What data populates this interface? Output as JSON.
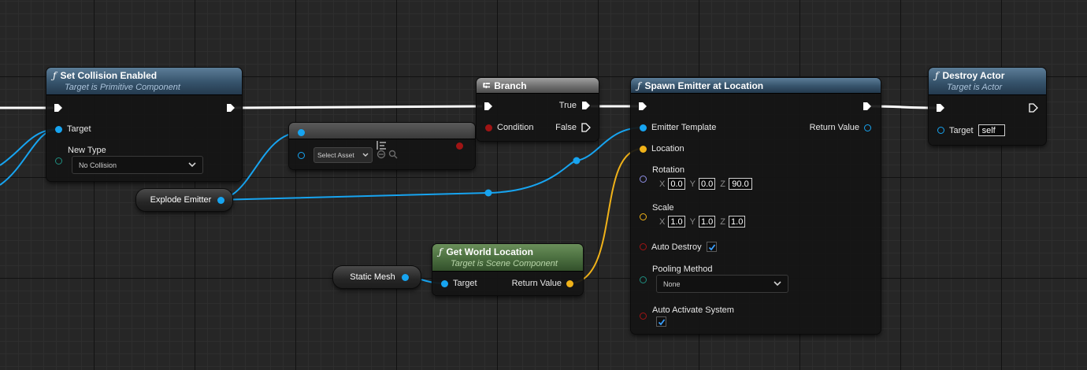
{
  "nodes": {
    "set_collision": {
      "title": "Set Collision Enabled",
      "subtitle": "Target is Primitive Component",
      "target_label": "Target",
      "new_type_label": "New Type",
      "new_type_value": "No Collision"
    },
    "select_asset": {
      "value": "Select Asset"
    },
    "branch": {
      "title": "Branch",
      "true_label": "True",
      "condition_label": "Condition",
      "false_label": "False"
    },
    "spawn_emitter": {
      "title": "Spawn Emitter at Location",
      "emitter_template_label": "Emitter Template",
      "return_value_label": "Return Value",
      "location_label": "Location",
      "rotation_label": "Rotation",
      "rotation": {
        "x": "0.0",
        "y": "0.0",
        "z": "90.0"
      },
      "scale_label": "Scale",
      "scale": {
        "x": "1.0",
        "y": "1.0",
        "z": "1.0"
      },
      "axis_x": "X",
      "axis_y": "Y",
      "axis_z": "Z",
      "auto_destroy_label": "Auto Destroy",
      "pooling_method_label": "Pooling Method",
      "pooling_method_value": "None",
      "auto_activate_label": "Auto Activate System"
    },
    "destroy_actor": {
      "title": "Destroy Actor",
      "subtitle": "Target is Actor",
      "target_label": "Target",
      "target_value": "self"
    },
    "get_world_location": {
      "title": "Get World Location",
      "subtitle": "Target is Scene Component",
      "target_label": "Target",
      "return_value_label": "Return Value"
    },
    "explode_emitter": {
      "label": "Explode Emitter"
    },
    "static_mesh": {
      "label": "Static Mesh"
    }
  },
  "colors": {
    "object_pin": "#17a4f0",
    "vector_pin": "#f0b219",
    "bool_pin": "#a01414",
    "exec_wire": "#ffffff",
    "function_header": "#36536b",
    "pure_header": "#4a6e3f"
  },
  "icons": {
    "function": "function-f-icon",
    "branch": "branch-icon",
    "dropdown": "chevron-down-icon",
    "check": "checkmark-icon"
  }
}
